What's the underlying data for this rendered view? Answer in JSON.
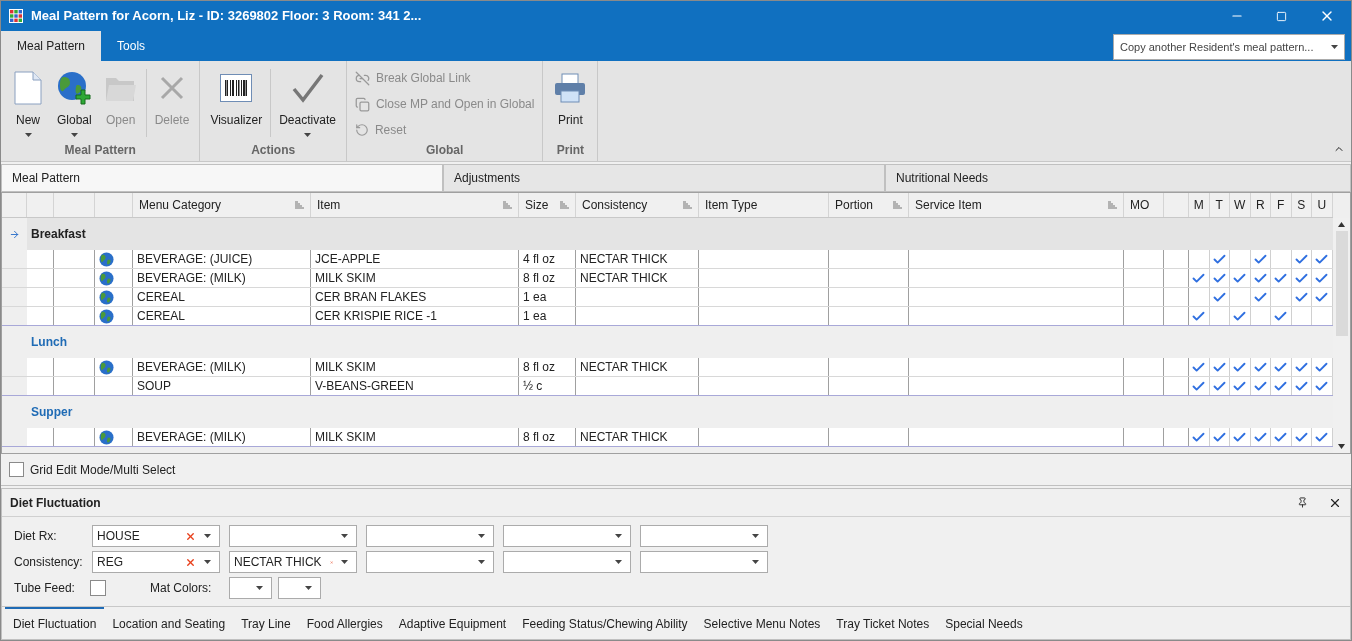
{
  "window": {
    "title": "Meal Pattern for Acorn, Liz - ID: 3269802 Floor: 3 Room: 341 2..."
  },
  "ribbon_tabs": [
    {
      "label": "Meal Pattern",
      "selected": true
    },
    {
      "label": "Tools",
      "selected": false
    }
  ],
  "copy_dropdown": {
    "placeholder": "Copy another Resident's meal pattern..."
  },
  "ribbon_groups": [
    {
      "title": "Meal Pattern",
      "buttons": [
        {
          "kind": "new",
          "label": "New",
          "dropdown": true,
          "disabled": false
        },
        {
          "kind": "global",
          "label": "Global",
          "dropdown": true,
          "disabled": false
        },
        {
          "kind": "open",
          "label": "Open",
          "dropdown": false,
          "disabled": true
        },
        {
          "kind": "delete",
          "label": "Delete",
          "dropdown": false,
          "disabled": true
        }
      ]
    },
    {
      "title": "Actions",
      "buttons": [
        {
          "kind": "visualizer",
          "label": "Visualizer",
          "dropdown": false,
          "disabled": false
        },
        {
          "kind": "deactivate",
          "label": "Deactivate",
          "dropdown": true,
          "disabled": false
        }
      ]
    },
    {
      "title": "Global",
      "small_buttons": [
        {
          "kind": "break",
          "label": "Break Global Link",
          "disabled": true
        },
        {
          "kind": "close",
          "label": "Close MP and Open in Global",
          "disabled": true
        },
        {
          "kind": "reset",
          "label": "Reset",
          "disabled": true
        }
      ]
    },
    {
      "title": "Print",
      "buttons": [
        {
          "kind": "print",
          "label": "Print",
          "dropdown": false,
          "disabled": false
        }
      ]
    }
  ],
  "section_tabs": [
    {
      "label": "Meal Pattern",
      "selected": true
    },
    {
      "label": "Adjustments",
      "selected": false
    },
    {
      "label": "Nutritional Needs",
      "selected": false
    }
  ],
  "grid": {
    "columns": [
      "Menu Category",
      "Item",
      "Size",
      "Consistency",
      "Item Type",
      "Portion",
      "Service Item",
      "MO",
      "M",
      "T",
      "W",
      "R",
      "F",
      "S",
      "U"
    ],
    "groups": [
      {
        "name": "Breakfast",
        "current": true,
        "rows": [
          {
            "globe": true,
            "category": "BEVERAGE: (JUICE)",
            "item": "JCE-APPLE",
            "size": "4 fl oz",
            "consistency": "NECTAR THICK",
            "days": [
              false,
              true,
              false,
              true,
              false,
              true,
              true
            ]
          },
          {
            "globe": true,
            "category": "BEVERAGE: (MILK)",
            "item": "MILK SKIM",
            "size": "8 fl oz",
            "consistency": "NECTAR THICK",
            "days": [
              true,
              true,
              true,
              true,
              true,
              true,
              true
            ]
          },
          {
            "globe": true,
            "category": "CEREAL",
            "item": "CER BRAN FLAKES",
            "size": "1 ea",
            "consistency": "",
            "days": [
              false,
              true,
              false,
              true,
              false,
              true,
              true
            ]
          },
          {
            "globe": true,
            "category": "CEREAL",
            "item": "CER KRISPIE RICE -1",
            "size": "1 ea",
            "consistency": "",
            "days": [
              true,
              false,
              true,
              false,
              true,
              false,
              false
            ]
          }
        ]
      },
      {
        "name": "Lunch",
        "current": false,
        "rows": [
          {
            "globe": true,
            "category": "BEVERAGE: (MILK)",
            "item": "MILK SKIM",
            "size": "8 fl oz",
            "consistency": "NECTAR THICK",
            "days": [
              true,
              true,
              true,
              true,
              true,
              true,
              true
            ]
          },
          {
            "globe": false,
            "category": "SOUP",
            "item": "V-BEANS-GREEN",
            "size": "½ c",
            "consistency": "",
            "days": [
              true,
              true,
              true,
              true,
              true,
              true,
              true
            ]
          }
        ]
      },
      {
        "name": "Supper",
        "current": false,
        "rows": [
          {
            "globe": true,
            "category": "BEVERAGE: (MILK)",
            "item": "MILK SKIM",
            "size": "8 fl oz",
            "consistency": "NECTAR THICK",
            "days": [
              true,
              true,
              true,
              true,
              true,
              true,
              true
            ]
          }
        ]
      }
    ]
  },
  "grid_edit_mode": {
    "label": "Grid Edit Mode/Multi Select",
    "checked": false
  },
  "diet_panel": {
    "title": "Diet Fluctuation",
    "rows": [
      {
        "label": "Diet Rx:",
        "values": [
          "HOUSE"
        ]
      },
      {
        "label": "Consistency:",
        "values": [
          "REG",
          "NECTAR THICK"
        ]
      }
    ],
    "tube_feed": {
      "label": "Tube Feed:",
      "checked": false
    },
    "mat_colors": {
      "label": "Mat Colors:"
    },
    "tabs": [
      {
        "label": "Diet Fluctuation",
        "selected": true
      },
      {
        "label": "Location and Seating",
        "selected": false
      },
      {
        "label": "Tray Line",
        "selected": false
      },
      {
        "label": "Food Allergies",
        "selected": false
      },
      {
        "label": "Adaptive Equipment",
        "selected": false
      },
      {
        "label": "Feeding Status/Chewing Ability",
        "selected": false
      },
      {
        "label": "Selective Menu Notes",
        "selected": false
      },
      {
        "label": "Tray Ticket Notes",
        "selected": false
      },
      {
        "label": "Special Needs",
        "selected": false
      }
    ]
  }
}
